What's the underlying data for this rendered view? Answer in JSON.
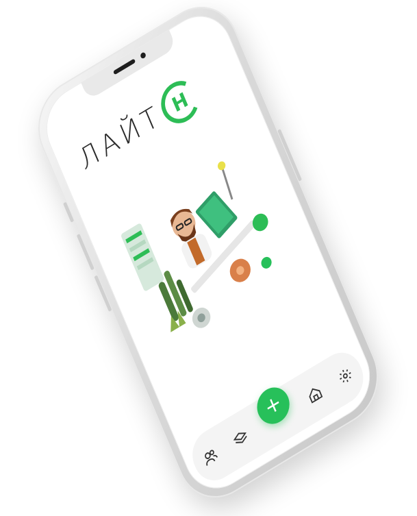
{
  "app": {
    "logo_text": "ЛАЙТ",
    "logo_letter": "Н",
    "brand_color": "#27c05a"
  },
  "tabbar": {
    "items": [
      {
        "icon": "users-icon"
      },
      {
        "icon": "layers-icon"
      },
      {
        "icon": "plus-icon",
        "label": "+"
      },
      {
        "icon": "home-icon"
      },
      {
        "icon": "settings-icon"
      }
    ]
  }
}
